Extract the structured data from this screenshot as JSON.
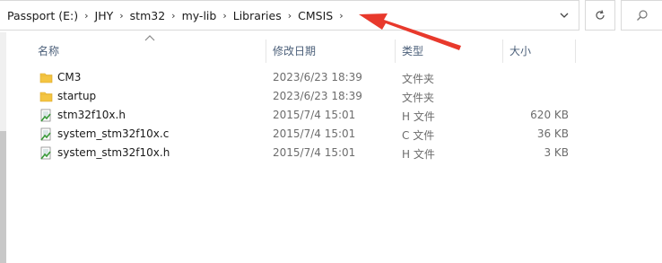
{
  "breadcrumbs": [
    "Passport (E:)",
    "JHY",
    "stm32",
    "my-lib",
    "Libraries",
    "CMSIS"
  ],
  "columns": {
    "name": "名称",
    "modified": "修改日期",
    "type": "类型",
    "size": "大小"
  },
  "files": [
    {
      "name": "CM3",
      "modified": "2023/6/23 18:39",
      "type": "文件夹",
      "size": "",
      "icon": "folder-icon"
    },
    {
      "name": "startup",
      "modified": "2023/6/23 18:39",
      "type": "文件夹",
      "size": "",
      "icon": "folder-icon"
    },
    {
      "name": "stm32f10x.h",
      "modified": "2015/7/4 15:01",
      "type": "H 文件",
      "size": "620 KB",
      "icon": "header-file-icon"
    },
    {
      "name": "system_stm32f10x.c",
      "modified": "2015/7/4 15:01",
      "type": "C 文件",
      "size": "36 KB",
      "icon": "c-file-icon"
    },
    {
      "name": "system_stm32f10x.h",
      "modified": "2015/7/4 15:01",
      "type": "H 文件",
      "size": "3 KB",
      "icon": "header-file-icon"
    }
  ],
  "colors": {
    "header_text": "#4c607a",
    "annotation_arrow": "#e8392c",
    "folder": "#f4c542"
  }
}
